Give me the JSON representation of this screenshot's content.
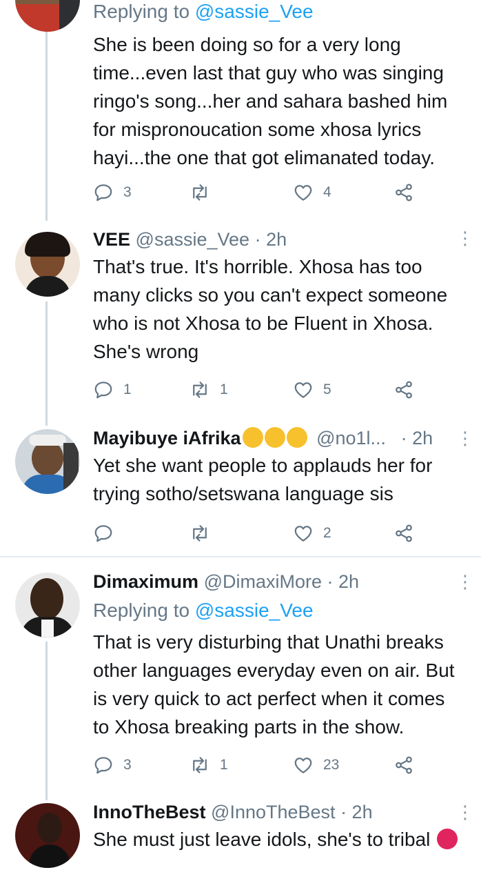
{
  "tweets": [
    {
      "reply_prefix": "Replying to",
      "reply_handle": "@sassie_Vee",
      "text_lines": [
        "She is been doing so for a very long",
        "time...even last that guy who was singing",
        "ringo's song...her and sahara bashed him",
        "for mispronoucation some xhosa lyrics",
        "hayi...the one that got elimanated today."
      ],
      "replies": "3",
      "retweets": "",
      "likes": "4"
    },
    {
      "name": "VEE",
      "handle": "@sassie_Vee",
      "time": "· 2h",
      "text_lines": [
        "That's true. It's horrible. Xhosa has too",
        "many clicks so you can't expect someone",
        "who is not Xhosa to be Fluent in Xhosa.",
        "She's wrong"
      ],
      "replies": "1",
      "retweets": "1",
      "likes": "5"
    },
    {
      "name": "Mayibuye iAfrika",
      "handle": "@no1l...",
      "time": "· 2h",
      "emojis": [
        "crying-face-emoji",
        "fist-emoji",
        "fist-emoji"
      ],
      "text_lines": [
        "Yet she want people to applauds her for",
        "trying sotho/setswana language sis"
      ],
      "replies": "",
      "retweets": "",
      "likes": "2"
    },
    {
      "name": "Dimaximum",
      "handle": "@DimaxiMore",
      "time": "· 2h",
      "reply_prefix": "Replying to",
      "reply_handle": "@sassie_Vee",
      "text_lines": [
        "That is very disturbing that Unathi breaks",
        "other languages everyday even on air. But",
        "is very quick to act perfect when it comes",
        "to Xhosa breaking parts in the show."
      ],
      "replies": "3",
      "retweets": "1",
      "likes": "23"
    },
    {
      "name": "InnoTheBest",
      "handle": "@InnoTheBest",
      "time": "· 2h",
      "emojis": [
        "angry-face-emoji"
      ],
      "text_lines": [
        "She must just leave idols, she's to tribal"
      ]
    }
  ],
  "colors": {
    "link": "#1da1f2",
    "secondary": "#657786",
    "text": "#14171a",
    "line": "#cfd9de",
    "divider": "#e6ecf0"
  },
  "icons": [
    "reply-icon",
    "retweet-icon",
    "like-icon",
    "share-icon",
    "more-options-icon"
  ]
}
